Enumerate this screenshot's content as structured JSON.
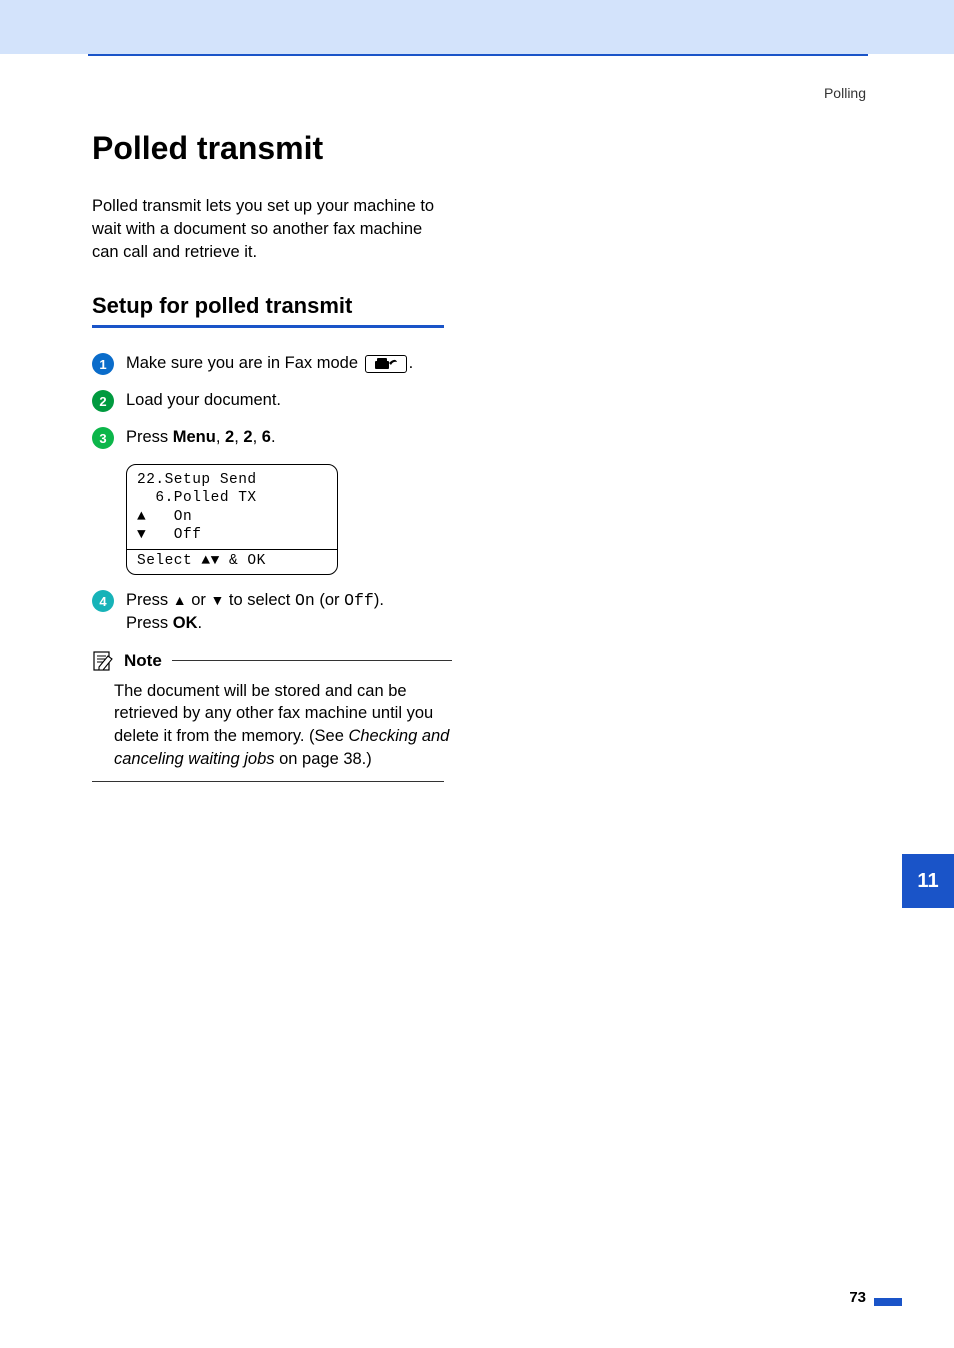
{
  "header": {
    "section": "Polling"
  },
  "title": "Polled transmit",
  "intro": "Polled transmit lets you set up your machine to wait with a document so another fax machine can call and retrieve it.",
  "subtitle": "Setup for polled transmit",
  "steps": {
    "s1": {
      "num": "1",
      "pre": "Make sure you are in Fax mode ",
      "post": "."
    },
    "s2": {
      "num": "2",
      "text": "Load your document."
    },
    "s3": {
      "num": "3",
      "pre": "Press ",
      "menu": "Menu",
      "sep1": ", ",
      "k1": "2",
      "sep2": ", ",
      "k2": "2",
      "sep3": ", ",
      "k3": "6",
      "post": "."
    },
    "lcd": {
      "l1": "22.Setup Send",
      "l2": "  6.Polled TX",
      "l3_arrow": "a",
      "l3_text": "   On",
      "l4_arrow": "b",
      "l4_text": "   Off",
      "l5_pre": "Select ",
      "l5_arrows": "ab",
      "l5_post": " & OK"
    },
    "s4": {
      "num": "4",
      "pre": "Press ",
      "mid1": " or ",
      "mid2": " to select ",
      "on": "On",
      "mid3": " (or ",
      "off": "Off",
      "mid4": ").",
      "line2a": "Press ",
      "ok": "OK",
      "line2b": "."
    }
  },
  "note": {
    "label": "Note",
    "body_pre": "The document will be stored and can be retrieved by any other fax machine until you delete it from the memory. (See ",
    "body_ital": "Checking and canceling waiting jobs",
    "body_post": " on page 38.)"
  },
  "chapter_tab": "11",
  "page_number": "73"
}
